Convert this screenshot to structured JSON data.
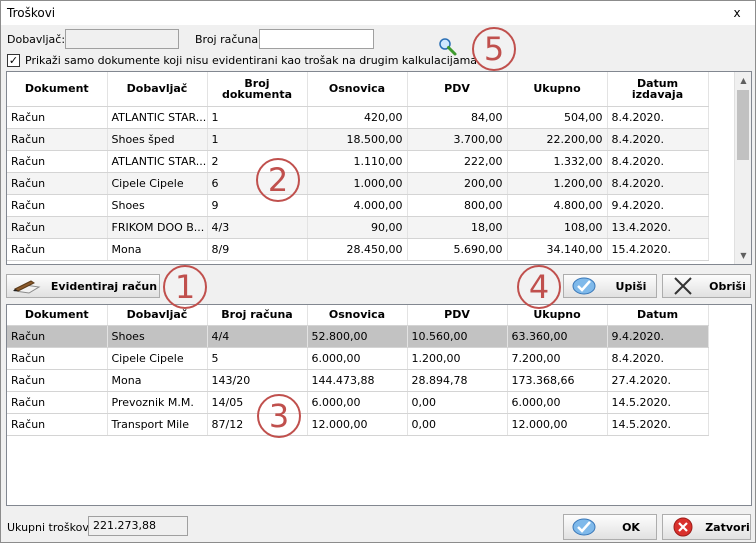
{
  "window": {
    "title": "Troškovi",
    "close_label": "x"
  },
  "filters": {
    "supplier_label": "Dobavljač:",
    "supplier_value": "",
    "invoice_label": "Broj računa:",
    "invoice_value": "",
    "checkbox_checked": "✓",
    "checkbox_label": "Prikaži samo dokumente koji nisu evidentirani kao trošak na drugim kalkulacijama"
  },
  "markers": [
    "1",
    "2",
    "3",
    "4",
    "5"
  ],
  "top_grid": {
    "columns": [
      "Dokument",
      "Dobavljač",
      "Broj dokumenta",
      "Osnovica",
      "PDV",
      "Ukupno",
      "Datum izdavaja"
    ],
    "rows": [
      [
        "Račun",
        "ATLANTIC STAR...",
        "1",
        "420,00",
        "84,00",
        "504,00",
        "8.4.2020."
      ],
      [
        "Račun",
        "Shoes šped",
        "1",
        "18.500,00",
        "3.700,00",
        "22.200,00",
        "8.4.2020."
      ],
      [
        "Račun",
        "ATLANTIC STAR...",
        "2",
        "1.110,00",
        "222,00",
        "1.332,00",
        "8.4.2020."
      ],
      [
        "Račun",
        "Cipele Cipele",
        "6",
        "1.000,00",
        "200,00",
        "1.200,00",
        "8.4.2020."
      ],
      [
        "Račun",
        "Shoes",
        "9",
        "4.000,00",
        "800,00",
        "4.800,00",
        "9.4.2020."
      ],
      [
        "Račun",
        "FRIKOM DOO B...",
        "4/3",
        "90,00",
        "18,00",
        "108,00",
        "13.4.2020."
      ],
      [
        "Račun",
        "Mona",
        "8/9",
        "28.450,00",
        "5.690,00",
        "34.140,00",
        "15.4.2020."
      ]
    ]
  },
  "actions": {
    "record_invoice": "Evidentiraj račun",
    "enter": "Upiši",
    "delete": "Obriši"
  },
  "bottom_grid": {
    "columns": [
      "Dokument",
      "Dobavljač",
      "Broj računa",
      "Osnovica",
      "PDV",
      "Ukupno",
      "Datum"
    ],
    "rows": [
      [
        "Račun",
        "Shoes",
        "4/4",
        "52.800,00",
        "10.560,00",
        "63.360,00",
        "9.4.2020."
      ],
      [
        "Račun",
        "Cipele Cipele",
        "5",
        "6.000,00",
        "1.200,00",
        "7.200,00",
        "8.4.2020."
      ],
      [
        "Račun",
        "Mona",
        "143/20",
        "144.473,88",
        "28.894,78",
        "173.368,66",
        "27.4.2020."
      ],
      [
        "Račun",
        "Prevoznik M.M.",
        "14/05",
        "6.000,00",
        "0,00",
        "6.000,00",
        "14.5.2020."
      ],
      [
        "Račun",
        "Transport Mile",
        "87/12",
        "12.000,00",
        "0,00",
        "12.000,00",
        "14.5.2020."
      ]
    ]
  },
  "footer": {
    "total_label": "Ukupni troškovi:",
    "total_value": "221.273,88",
    "ok": "OK",
    "close": "Zatvori"
  },
  "colors": {
    "marker": "#c0504d",
    "selected_row": "#c2c2c2",
    "ok_check": "#3a8fd9",
    "close_red": "#d9302c"
  }
}
